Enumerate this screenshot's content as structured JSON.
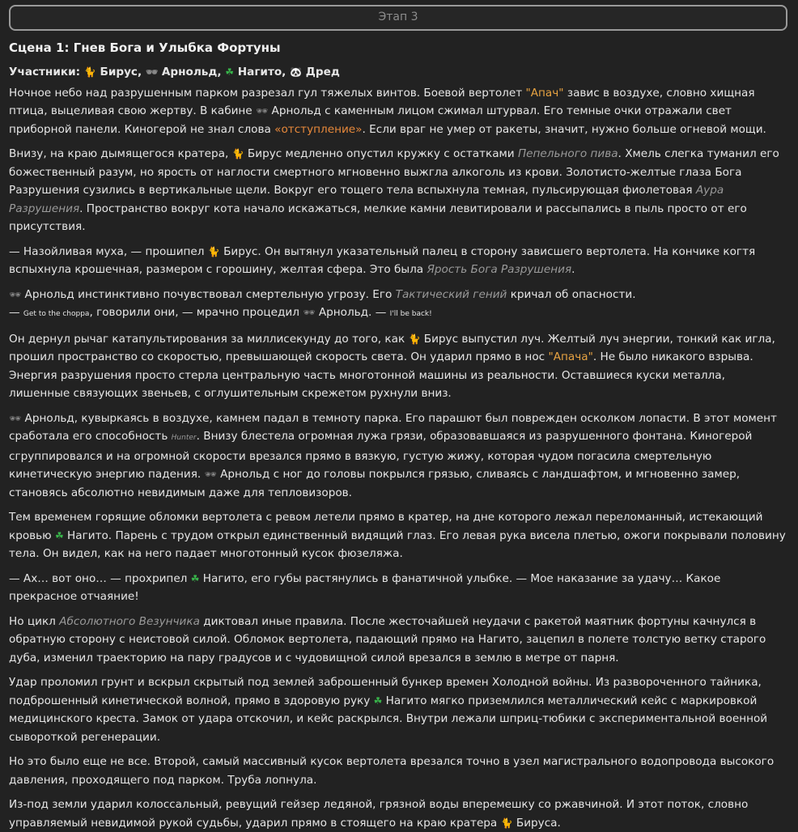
{
  "stage_button": "Этап 3",
  "scene_title": "Сцена 1: Гнев Бога и Улыбка Фортуны",
  "participants": {
    "label": "Участники:",
    "names": [
      "Бирус,",
      "Арнольд,",
      "Нагито,",
      "Дред"
    ]
  },
  "icons": {
    "cat": "cat-icon",
    "glasses": "sunglasses-icon",
    "clover": "clover-icon",
    "panda": "panda-icon"
  },
  "p1": {
    "a": "Ночное небо над разрушенным парком разрезал гул тяжелых винтов. Боевой вертолет ",
    "apache": "\"Апач\"",
    "b": " завис в воздухе, словно хищная птица, выцеливая свою жертву. В кабине ",
    "c": " Арнольд с каменным лицом сжимал штурвал. Его темные очки отражали свет приборной панели. Киногерой не знал слова ",
    "retreat": "«отступление»",
    "d": ". Если враг не умер от ракеты, значит, нужно больше огневой мощи."
  },
  "p2": {
    "a": "Внизу, на краю дымящегося кратера, ",
    "b": " Бирус медленно опустил кружку с остатками ",
    "beer": "Пепельного пива",
    "c": ". Хмель слегка туманил его божественный разум, но ярость от наглости смертного мгновенно выжгла алкоголь из крови. Золотисто-желтые глаза Бога Разрушения сузились в вертикальные щели. Вокруг его тощего тела вспыхнула темная, пульсирующая фиолетовая ",
    "aura": "Аура Разрушения",
    "d": ". Пространство вокруг кота начало искажаться, мелкие камни левитировали и рассыпались в пыль просто от его присутствия."
  },
  "p3": {
    "a": "— Назойливая муха, — прошипел ",
    "b": " Бирус. Он вытянул указательный палец в сторону зависшего вертолета. На кончике когтя вспыхнула крошечная, размером с горошину, желтая сфера. Это была ",
    "fury": "Ярость Бога Разрушения",
    "c": "."
  },
  "p4": {
    "a": " Арнольд инстинктивно почувствовал смертельную угрозу. Его ",
    "genius": "Тактический гений",
    "b": " кричал об опасности.",
    "c": "— ",
    "chopper": "Get to the choppa",
    "d": ", говорили они, — мрачно процедил ",
    "e": " Арнольд. — ",
    "back": "I'll be back!"
  },
  "p5": {
    "a": "Он дернул рычаг катапультирования за миллисекунду до того, как ",
    "b": " Бирус выпустил луч. Желтый луч энергии, тонкий как игла, прошил пространство со скоростью, превышающей скорость света. Он ударил прямо в нос ",
    "apache": "\"Апача\"",
    "c": ". Не было никакого взрыва. Энергия разрушения просто стерла центральную часть многотонной машины из реальности. Оставшиеся куски металла, лишенные связующих звеньев, с оглушительным скрежетом рухнули вниз."
  },
  "p6": {
    "a": " Арнольд, кувыркаясь в воздухе, камнем падал в темноту парка. Его парашют был поврежден осколком лопасти. В этот момент сработала его способность ",
    "hunter": "Hunter",
    "b": ". Внизу блестела огромная лужа грязи, образовавшаяся из разрушенного фонтана. Киногерой сгруппировался и на огромной скорости врезался прямо в вязкую, густую жижу, которая чудом погасила смертельную кинетическую энергию падения. ",
    "c": " Арнольд с ног до головы покрылся грязью, сливаясь с ландшафтом, и мгновенно замер, становясь абсолютно невидимым даже для тепловизоров."
  },
  "p7": {
    "a": "Тем временем горящие обломки вертолета с ревом летели прямо в кратер, на дне которого лежал переломанный, истекающий кровью ",
    "b": " Нагито. Парень с трудом открыл единственный видящий глаз. Его левая рука висела плетью, ожоги покрывали половину тела. Он видел, как на него падает многотонный кусок фюзеляжа."
  },
  "p8": {
    "a": "— Ах… вот оно… — прохрипел ",
    "b": " Нагито, его губы растянулись в фанатичной улыбке. — Мое наказание за удачу… Какое прекрасное отчаяние!"
  },
  "p9": {
    "a": "Но цикл ",
    "cycle": "Абсолютного Везунчика",
    "b": " диктовал иные правила. После жесточайшей неудачи с ракетой маятник фортуны качнулся в обратную сторону с неистовой силой. Обломок вертолета, падающий прямо на Нагито, зацепил в полете толстую ветку старого дуба, изменил траекторию на пару градусов и с чудовищной силой врезался в землю в метре от парня."
  },
  "p10": {
    "a": "Удар проломил грунт и вскрыл скрытый под землей заброшенный бункер времен Холодной войны. Из развороченного тайника, подброшенный кинетической волной, прямо в здоровую руку ",
    "b": " Нагито мягко приземлился металлический кейс с маркировкой медицинского креста. Замок от удара отскочил, и кейс раскрылся. Внутри лежали шприц-тюбики с экспериментальной военной сывороткой регенерации."
  },
  "p11": "Но это было еще не все. Второй, самый массивный кусок вертолета врезался точно в узел магистрального водопровода высокого давления, проходящего под парком. Труба лопнула.",
  "p12": {
    "a": "Из-под земли ударил колоссальный, ревущий гейзер ледяной, грязной воды вперемешку со ржавчиной. И этот поток, словно управляемый невидимой рукой судьбы, ударил прямо в стоящего на краю кратера ",
    "b": " Бируса."
  }
}
